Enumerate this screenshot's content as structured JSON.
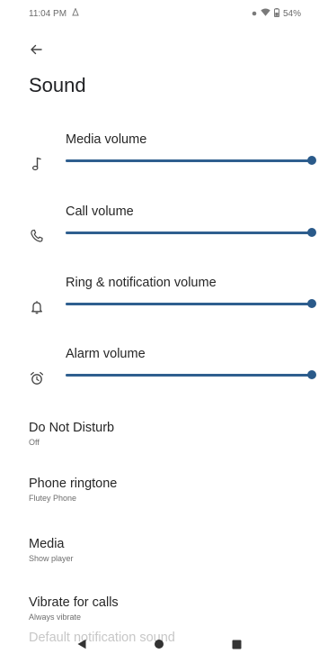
{
  "status_bar": {
    "time": "11:04 PM",
    "battery": "54%"
  },
  "page": {
    "title": "Sound"
  },
  "volumes": [
    {
      "label": "Media volume",
      "icon": "music-note-icon",
      "level_percent": 100
    },
    {
      "label": "Call volume",
      "icon": "phone-icon",
      "level_percent": 100
    },
    {
      "label": "Ring & notification volume",
      "icon": "bell-icon",
      "level_percent": 100
    },
    {
      "label": "Alarm volume",
      "icon": "alarm-clock-icon",
      "level_percent": 100
    }
  ],
  "settings": [
    {
      "title": "Do Not Disturb",
      "subtitle": "Off"
    },
    {
      "title": "Phone ringtone",
      "subtitle": "Flutey Phone"
    },
    {
      "title": "Media",
      "subtitle": "Show player"
    },
    {
      "title": "Vibrate for calls",
      "subtitle": "Always vibrate"
    }
  ],
  "partially_visible_setting": "Default notification sound",
  "colors": {
    "accent": "#2f5f8f",
    "track": "#c8d6e6",
    "text_primary": "#262626",
    "text_secondary": "#6e6e6e"
  }
}
